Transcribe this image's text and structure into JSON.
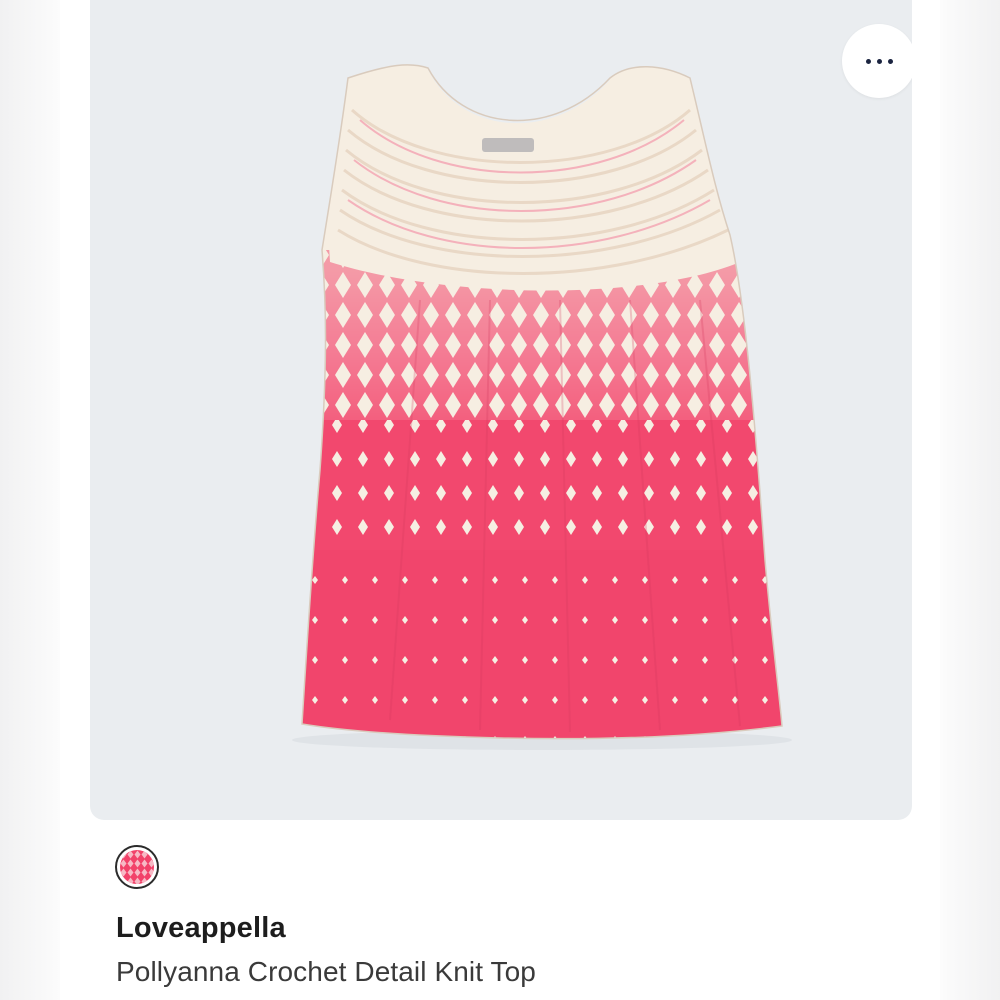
{
  "product": {
    "brand": "Loveappella",
    "name": "Pollyanna Crochet Detail Knit Top",
    "image_description_icon": "sleeveless-top-icon",
    "swatch_icon": "color-swatch-icon"
  },
  "actions": {
    "more_icon": "more-horizontal-icon"
  },
  "colors": {
    "garment_coral": "#f2426a",
    "garment_cream": "#f6eee2",
    "panel_background": "#eaedf0",
    "more_dots": "#1b2440"
  }
}
